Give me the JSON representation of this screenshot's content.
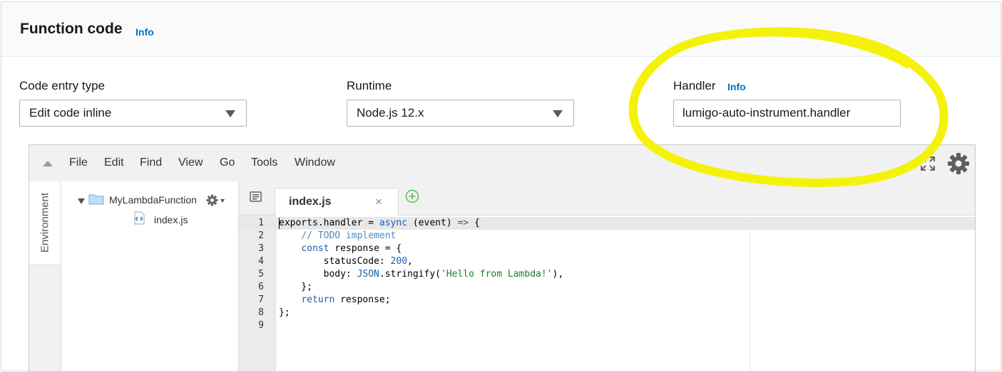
{
  "panel": {
    "title": "Function code",
    "info_label": "Info"
  },
  "fields": {
    "code_entry": {
      "label": "Code entry type",
      "value": "Edit code inline"
    },
    "runtime": {
      "label": "Runtime",
      "value": "Node.js 12.x"
    },
    "handler": {
      "label": "Handler",
      "info_label": "Info",
      "value": "lumigo-auto-instrument.handler"
    }
  },
  "ide": {
    "menu": [
      "File",
      "Edit",
      "Find",
      "View",
      "Go",
      "Tools",
      "Window"
    ],
    "sidebar_tab": "Environment",
    "tree": {
      "folder": "MyLambdaFunction",
      "file": "index.js"
    },
    "tab": {
      "label": "index.js",
      "close": "×"
    },
    "line_numbers": [
      "1",
      "2",
      "3",
      "4",
      "5",
      "6",
      "7",
      "8",
      "9"
    ]
  },
  "code": {
    "l1": {
      "a": "exports.handler = ",
      "b": "async",
      "c": " (event) ",
      "d": "=>",
      "e": " {"
    },
    "l2": {
      "a": "    ",
      "b": "// TODO implement"
    },
    "l3": {
      "a": "    ",
      "b": "const",
      "c": " response = {"
    },
    "l4": {
      "a": "        statusCode: ",
      "b": "200",
      "c": ","
    },
    "l5": {
      "a": "        body: ",
      "b": "JSON",
      "c": ".stringify(",
      "d": "'Hello from Lambda!'",
      "e": "),"
    },
    "l6": {
      "a": "    };"
    },
    "l7": {
      "a": "    ",
      "b": "return",
      "c": " response;"
    },
    "l8": {
      "a": "};"
    }
  },
  "colors": {
    "link": "#0073bb",
    "highlight": "#f4f20a",
    "keyword": "#1a5fb4",
    "string": "#1e7b2c"
  }
}
